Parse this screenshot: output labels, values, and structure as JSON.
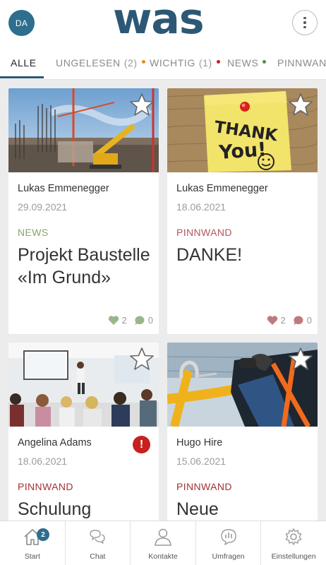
{
  "header": {
    "avatar_initials": "DA",
    "logo_text": "was",
    "menu_icon": "more-vertical-icon"
  },
  "tabs": [
    {
      "label": "ALLE",
      "count": "",
      "active": true,
      "dot_color": ""
    },
    {
      "label": "UNGELESEN",
      "count": "(2)",
      "active": false,
      "dot_color": "#e8891e"
    },
    {
      "label": "WICHTIG",
      "count": "(1)",
      "active": false,
      "dot_color": "#c8201e"
    },
    {
      "label": "NEWS",
      "count": "",
      "active": false,
      "dot_color": "#5a8a4a"
    },
    {
      "label": "PINNWAND",
      "count": "",
      "active": false,
      "dot_color": ""
    }
  ],
  "posts": [
    {
      "author": "Lukas Emmenegger",
      "date": "29.09.2021",
      "category": "NEWS",
      "category_color": "#8aa36e",
      "title": "Projekt Baustelle «Im Grund»",
      "likes": "2",
      "comments": "0",
      "stats_color": "#9bb58a",
      "image": "construction-site-photo",
      "important": false
    },
    {
      "author": "Lukas Emmenegger",
      "date": "18.06.2021",
      "category": "PINNWAND",
      "category_color": "#b3565a",
      "title": "DANKE!",
      "likes": "2",
      "comments": "0",
      "stats_color": "#c07a7e",
      "image": "thank-you-note-photo",
      "image_text_1": "THANK",
      "image_text_2": "You!",
      "important": false
    },
    {
      "author": "Angelina Adams",
      "date": "18.06.2021",
      "category": "PINNWAND",
      "category_color": "#a33234",
      "title": "Schulung",
      "image": "training-seminar-photo",
      "important": true,
      "important_symbol": "!"
    },
    {
      "author": "Hugo Hire",
      "date": "15.06.2021",
      "category": "PINNWAND",
      "category_color": "#a33234",
      "title": "Neue",
      "image": "safety-harness-photo",
      "important": false
    }
  ],
  "bottom_nav": [
    {
      "label": "Start",
      "icon": "home-icon",
      "badge": "2"
    },
    {
      "label": "Chat",
      "icon": "chat-icon",
      "badge": ""
    },
    {
      "label": "Kontakte",
      "icon": "contact-icon",
      "badge": ""
    },
    {
      "label": "Umfragen",
      "icon": "poll-icon",
      "badge": ""
    },
    {
      "label": "Einstellungen",
      "icon": "settings-icon",
      "badge": ""
    }
  ]
}
